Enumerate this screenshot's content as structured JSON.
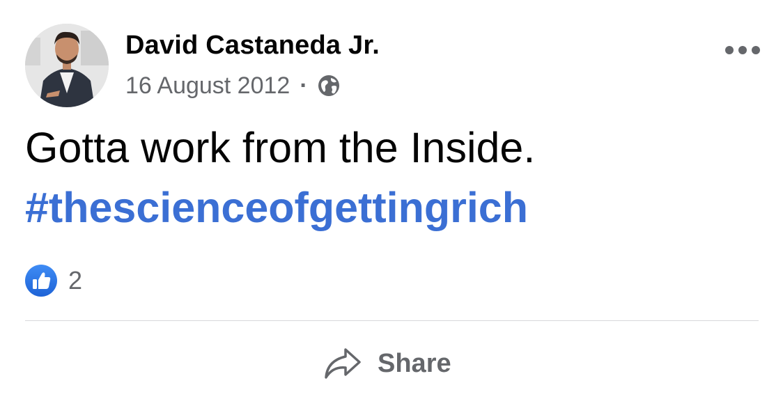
{
  "post": {
    "author": "David Castaneda Jr.",
    "date": "16 August 2012",
    "separator": "·",
    "privacy_icon": "globe-icon",
    "more_icon": "more-options-icon",
    "text": "Gotta work from the Inside.",
    "hashtag": "#thescienceofgettingrich"
  },
  "reactions": {
    "icon": "like-icon",
    "count": "2"
  },
  "actions": {
    "share_label": "Share",
    "share_icon": "share-icon"
  },
  "colors": {
    "hashtag": "#3b6fd4",
    "like": "#2d74e8",
    "secondary_text": "#65676b",
    "primary_text": "#050505"
  }
}
